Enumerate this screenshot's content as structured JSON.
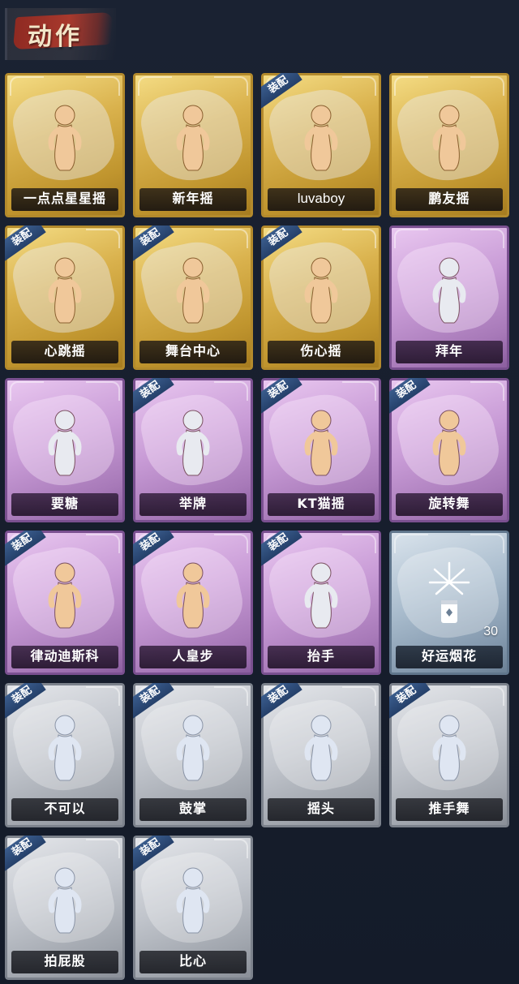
{
  "header": {
    "title": "动作"
  },
  "colors": {
    "gold": "#d9b14c",
    "purple": "#c89bd6",
    "blue": "#a9bccd",
    "gray": "#c1c5cc",
    "equip_tag": "#2f4d7a",
    "background": "#151d2c"
  },
  "cards": [
    {
      "label": "一点点星星摇",
      "rarity": "gold",
      "equipped": false,
      "icon": "figure-blow-kiss-icon"
    },
    {
      "label": "新年摇",
      "rarity": "gold",
      "equipped": false,
      "icon": "figure-sway-icon"
    },
    {
      "label": "luvaboy",
      "rarity": "gold",
      "equipped": true,
      "icon": "figure-arms-crossed-icon"
    },
    {
      "label": "鹏友摇",
      "rarity": "gold",
      "equipped": false,
      "icon": "figure-point-icon"
    },
    {
      "label": "心跳摇",
      "rarity": "gold",
      "equipped": true,
      "icon": "figure-wave-icon"
    },
    {
      "label": "舞台中心",
      "rarity": "gold",
      "equipped": true,
      "icon": "figure-center-stage-icon"
    },
    {
      "label": "伤心摇",
      "rarity": "gold",
      "equipped": true,
      "icon": "figure-heart-hands-icon"
    },
    {
      "label": "拜年",
      "rarity": "purple",
      "equipped": false,
      "icon": "figure-bow-icon"
    },
    {
      "label": "要糖",
      "rarity": "purple",
      "equipped": false,
      "icon": "figure-reach-icon"
    },
    {
      "label": "举牌",
      "rarity": "purple",
      "equipped": true,
      "icon": "figure-hold-sign-icon"
    },
    {
      "label": "KT猫摇",
      "rarity": "purple",
      "equipped": true,
      "icon": "figure-cat-sway-icon"
    },
    {
      "label": "旋转舞",
      "rarity": "purple",
      "equipped": true,
      "icon": "figure-spin-icon"
    },
    {
      "label": "律动迪斯科",
      "rarity": "purple",
      "equipped": true,
      "icon": "figure-disco-icon"
    },
    {
      "label": "人皇步",
      "rarity": "purple",
      "equipped": true,
      "icon": "figure-step-icon"
    },
    {
      "label": "抬手",
      "rarity": "purple",
      "equipped": true,
      "icon": "figure-raise-hand-icon"
    },
    {
      "label": "好运烟花",
      "rarity": "blue",
      "equipped": false,
      "icon": "firework-icon",
      "count": "30"
    },
    {
      "label": "不可以",
      "rarity": "gray",
      "equipped": true,
      "icon": "finger-wag-icon"
    },
    {
      "label": "鼓掌",
      "rarity": "gray",
      "equipped": true,
      "icon": "clap-icon"
    },
    {
      "label": "摇头",
      "rarity": "gray",
      "equipped": true,
      "icon": "figure-shake-head-icon"
    },
    {
      "label": "推手舞",
      "rarity": "gray",
      "equipped": true,
      "icon": "figure-push-dance-icon"
    },
    {
      "label": "拍屁股",
      "rarity": "gray",
      "equipped": true,
      "icon": "figure-slap-icon"
    },
    {
      "label": "比心",
      "rarity": "gray",
      "equipped": true,
      "icon": "figure-finger-heart-icon"
    }
  ],
  "equip_tag_label": "装配"
}
